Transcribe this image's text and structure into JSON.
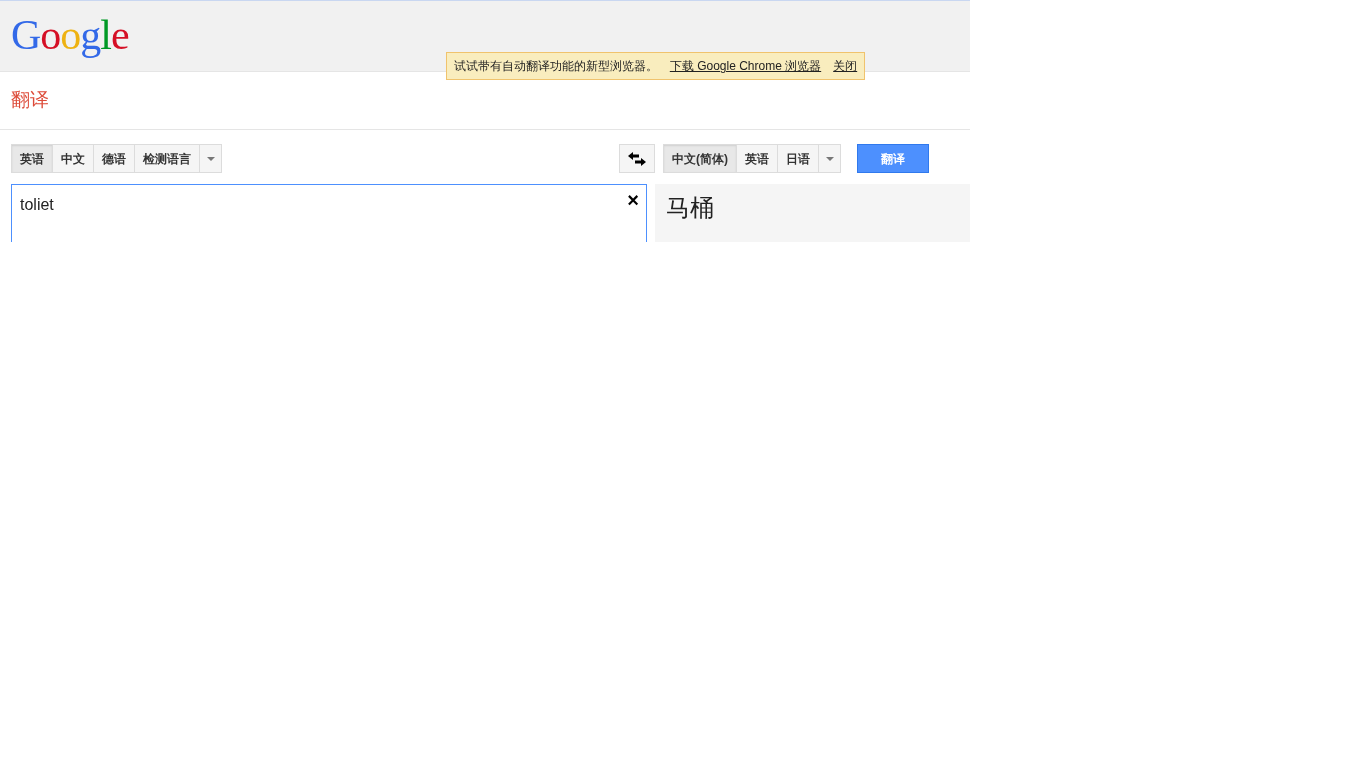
{
  "logo": "Google",
  "banner": {
    "message": "试试带有自动翻译功能的新型浏览器。",
    "link": "下载 Google Chrome 浏览器",
    "close": "关闭"
  },
  "page_title": "翻译",
  "source_languages": [
    {
      "label": "英语",
      "selected": true
    },
    {
      "label": "中文",
      "selected": false
    },
    {
      "label": "德语",
      "selected": false
    },
    {
      "label": "检测语言",
      "selected": false
    }
  ],
  "target_languages": [
    {
      "label": "中文(简体)",
      "selected": true
    },
    {
      "label": "英语",
      "selected": false
    },
    {
      "label": "日语",
      "selected": false
    }
  ],
  "translate_button": "翻译",
  "source_text": "toliet",
  "clear_button": "×",
  "result": "马桶"
}
